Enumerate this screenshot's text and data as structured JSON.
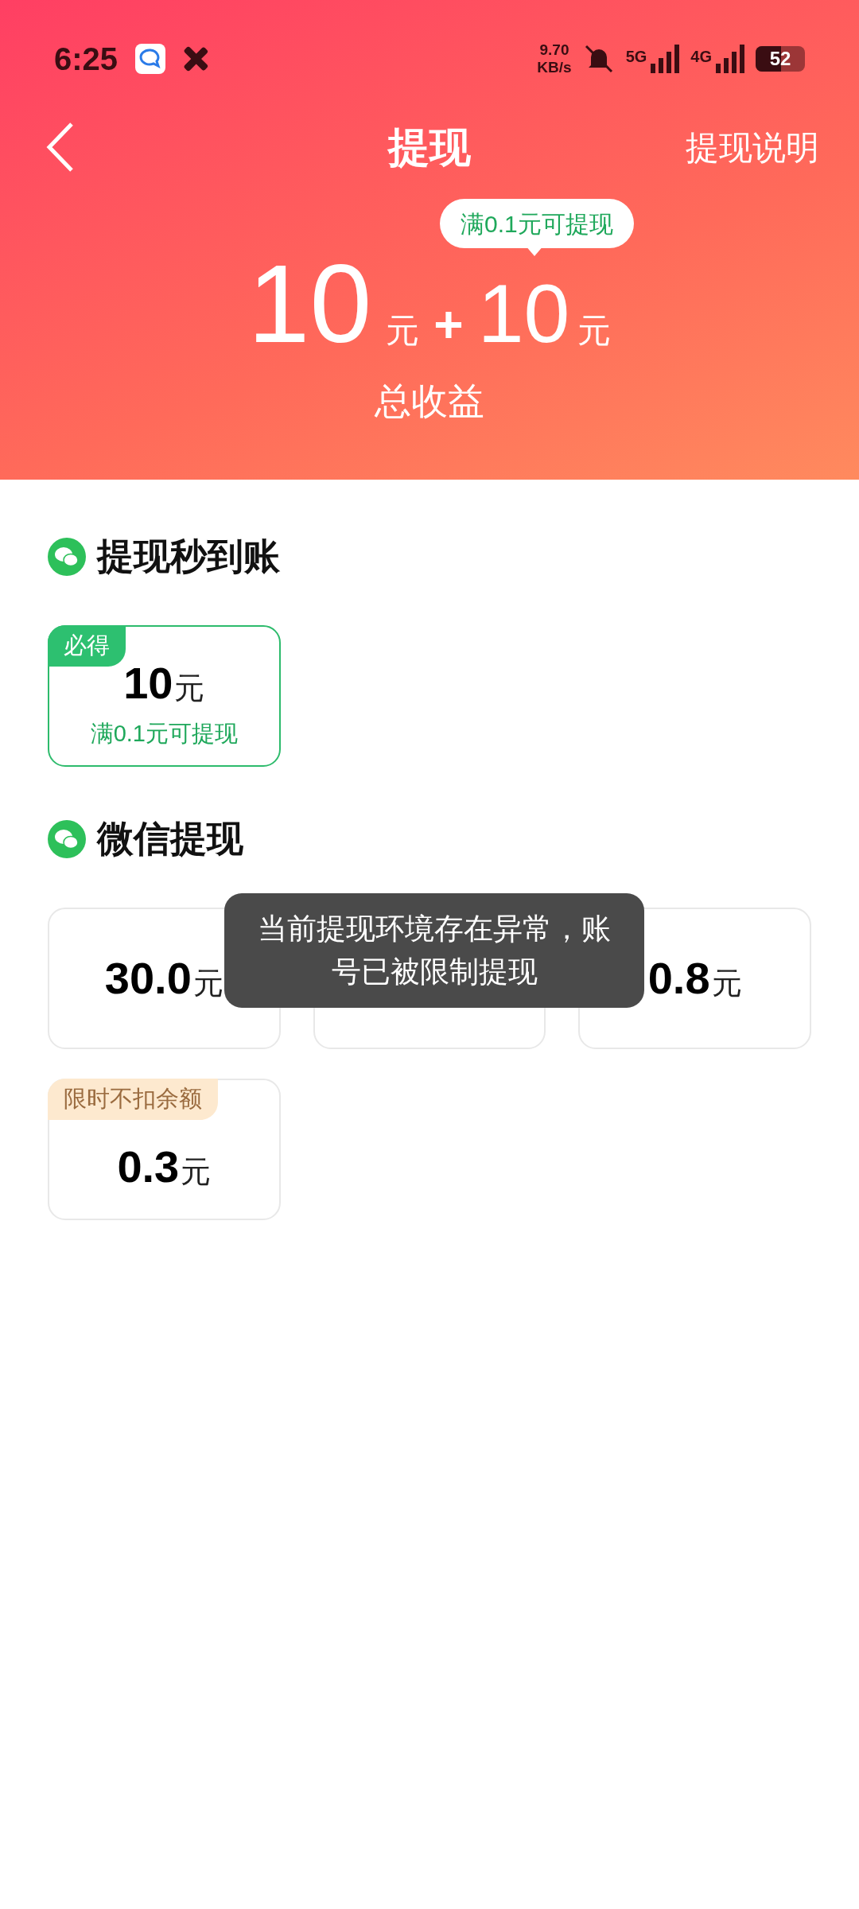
{
  "status_bar": {
    "time": "6:25",
    "net_speed": [
      "9.70",
      "KB/s"
    ],
    "network_labels": [
      "5G",
      "4G"
    ],
    "battery": "52"
  },
  "header": {
    "title": "提现",
    "link": "提现说明",
    "tooltip": "满0.1元可提现",
    "amount_a": "10",
    "unit_a": "元",
    "plus": "+",
    "amount_b": "10",
    "unit_b": "元",
    "caption": "总收益"
  },
  "sections": [
    {
      "title": "提现秒到账",
      "options": [
        {
          "kind": "featured",
          "badge": "必得",
          "amount": "10",
          "unit": "元",
          "note": "满0.1元可提现"
        }
      ]
    },
    {
      "title": "微信提现",
      "options": [
        {
          "kind": "plain",
          "amount": "30.0",
          "unit": "元"
        },
        {
          "kind": "plain"
        },
        {
          "kind": "plain",
          "amount": "0.8",
          "unit": "元"
        },
        {
          "kind": "promo",
          "badge": "限时不扣余额",
          "amount": "0.3",
          "unit": "元"
        }
      ]
    }
  ],
  "toast": "当前提现环境存在异常，账号已被限制提现"
}
